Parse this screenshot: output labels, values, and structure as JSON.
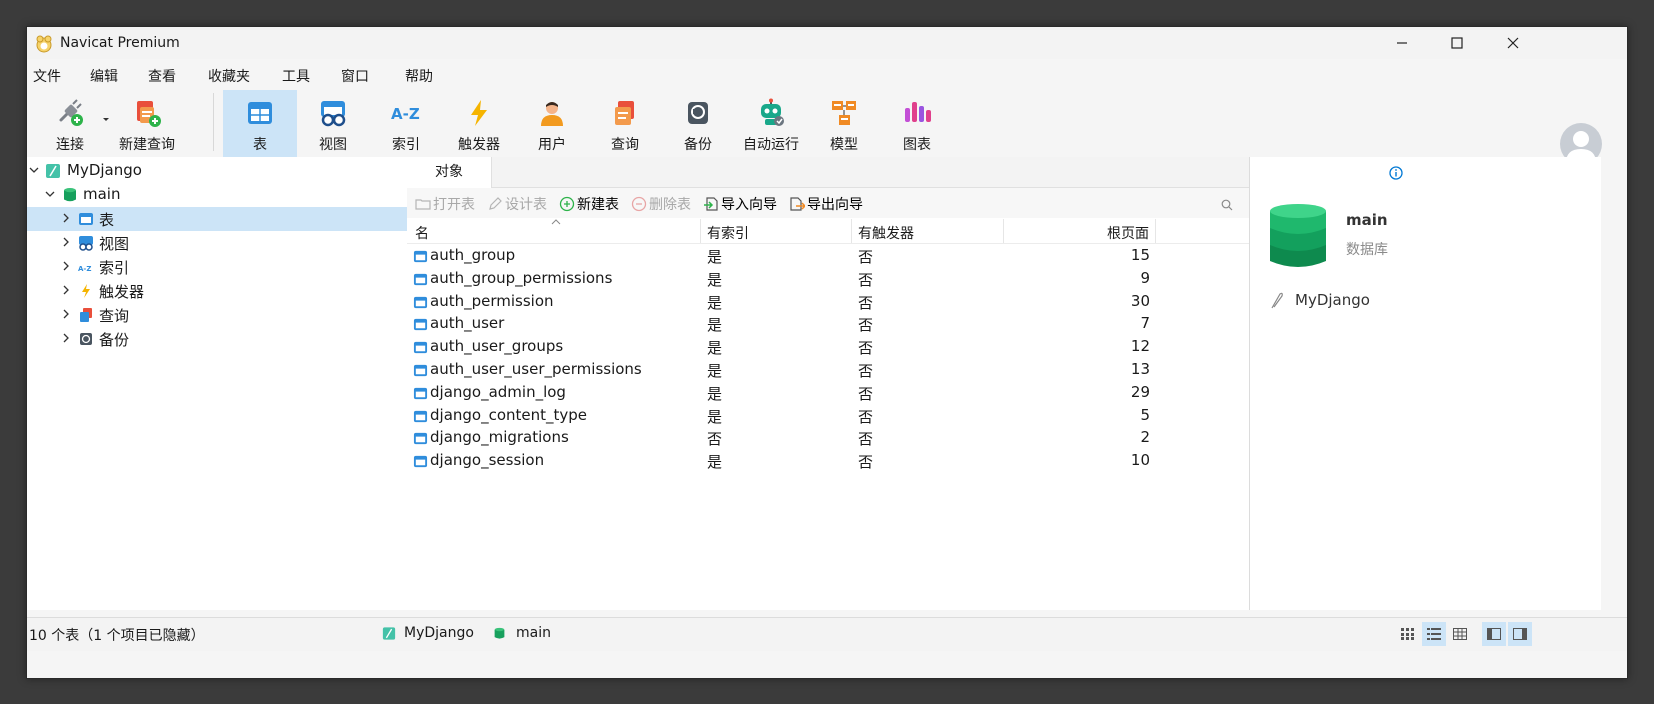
{
  "window": {
    "title": "Navicat Premium"
  },
  "menu": [
    "文件",
    "编辑",
    "查看",
    "收藏夹",
    "工具",
    "窗口",
    "帮助"
  ],
  "toolbar": {
    "connect": "连接",
    "new_query": "新建查询",
    "table": "表",
    "view": "视图",
    "index": "索引",
    "trigger": "触发器",
    "user": "用户",
    "query": "查询",
    "backup": "备份",
    "automation": "自动运行",
    "model": "模型",
    "chart": "图表"
  },
  "tree": {
    "connection": "MyDjango",
    "database": "main",
    "items": [
      "表",
      "视图",
      "索引",
      "触发器",
      "查询",
      "备份"
    ]
  },
  "tabs": {
    "objects": "对象"
  },
  "objbar": {
    "open_table": "打开表",
    "design_table": "设计表",
    "new_table": "新建表",
    "delete_table": "删除表",
    "import_wizard": "导入向导",
    "export_wizard": "导出向导"
  },
  "grid": {
    "columns": [
      "名",
      "有索引",
      "有触发器",
      "根页面"
    ],
    "rows": [
      {
        "name": "auth_group",
        "has_index": "是",
        "has_trigger": "否",
        "root_page": "15"
      },
      {
        "name": "auth_group_permissions",
        "has_index": "是",
        "has_trigger": "否",
        "root_page": "9"
      },
      {
        "name": "auth_permission",
        "has_index": "是",
        "has_trigger": "否",
        "root_page": "30"
      },
      {
        "name": "auth_user",
        "has_index": "是",
        "has_trigger": "否",
        "root_page": "7"
      },
      {
        "name": "auth_user_groups",
        "has_index": "是",
        "has_trigger": "否",
        "root_page": "12"
      },
      {
        "name": "auth_user_user_permissions",
        "has_index": "是",
        "has_trigger": "否",
        "root_page": "13"
      },
      {
        "name": "django_admin_log",
        "has_index": "是",
        "has_trigger": "否",
        "root_page": "29"
      },
      {
        "name": "django_content_type",
        "has_index": "是",
        "has_trigger": "否",
        "root_page": "5"
      },
      {
        "name": "django_migrations",
        "has_index": "否",
        "has_trigger": "否",
        "root_page": "2"
      },
      {
        "name": "django_session",
        "has_index": "是",
        "has_trigger": "否",
        "root_page": "10"
      }
    ]
  },
  "info": {
    "name": "main",
    "type": "数据库",
    "connection": "MyDjango"
  },
  "status": {
    "count": "10 个表（1 个项目已隐藏）",
    "connection": "MyDjango",
    "database": "main"
  },
  "colors": {
    "accent": "#0078d4",
    "selection": "#cce4f7",
    "db_green": "#17a05d"
  }
}
